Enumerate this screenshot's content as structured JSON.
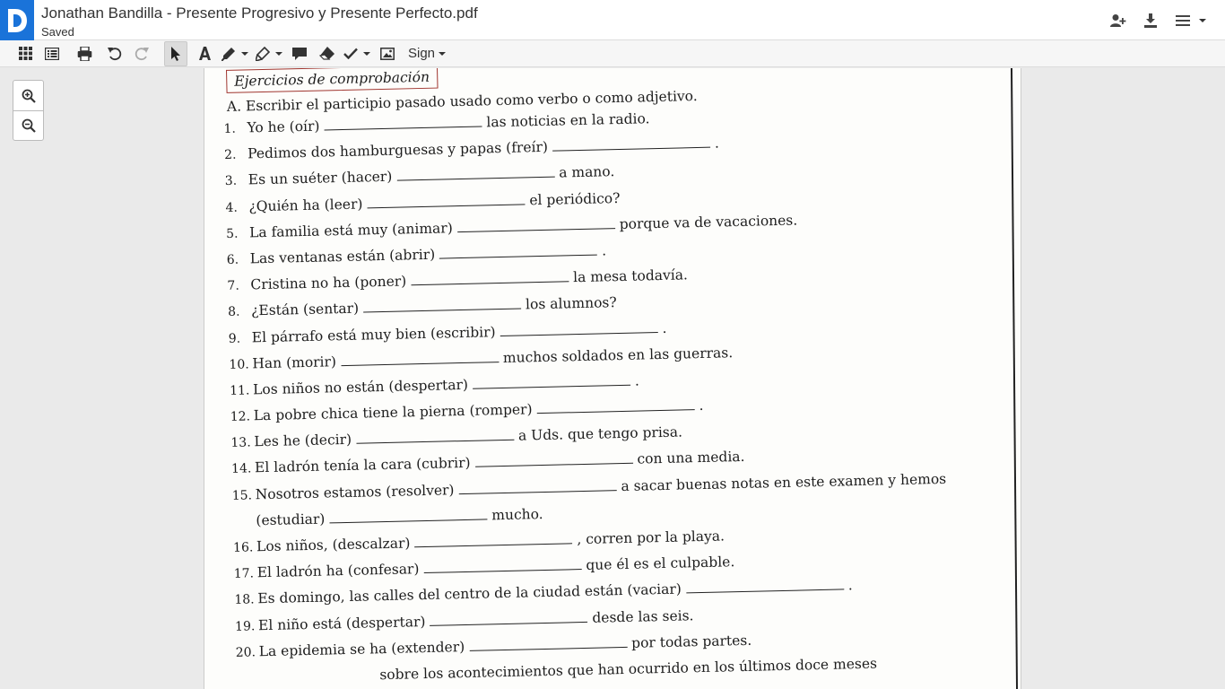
{
  "app": {
    "title": "Jonathan Bandilla - Presente Progresivo y Presente Perfecto.pdf",
    "status": "Saved",
    "logo_letter": "D",
    "accent": "#1a73d9"
  },
  "header_icons": [
    "add-user-icon",
    "download-icon",
    "menu-icon"
  ],
  "toolbar": {
    "sign_label": "Sign",
    "tools": [
      "grid-icon",
      "list-icon",
      "print-icon",
      "undo-icon",
      "redo-icon",
      "select-icon",
      "text-icon",
      "draw-icon",
      "highlight-icon",
      "comment-icon",
      "eraser-icon",
      "check-icon",
      "image-icon"
    ]
  },
  "zoom": [
    "zoom-in-icon",
    "zoom-out-icon"
  ],
  "document": {
    "section_title": "Ejercicios de comprobación",
    "instruction": "A. Escribir el participio pasado usado como verbo o como adjetivo.",
    "items": [
      {
        "n": "1.",
        "pre": "Yo he (oír)",
        "post": "las noticias en la radio."
      },
      {
        "n": "2.",
        "pre": "Pedimos dos hamburguesas y papas (freír)",
        "post": "."
      },
      {
        "n": "3.",
        "pre": "Es un suéter (hacer)",
        "post": "a mano."
      },
      {
        "n": "4.",
        "pre": "¿Quién ha (leer)",
        "post": "el periódico?"
      },
      {
        "n": "5.",
        "pre": "La familia está muy (animar)",
        "post": "porque va de vacaciones."
      },
      {
        "n": "6.",
        "pre": "Las ventanas están (abrir)",
        "post": "."
      },
      {
        "n": "7.",
        "pre": "Cristina no ha (poner)",
        "post": "la mesa todavía."
      },
      {
        "n": "8.",
        "pre": "¿Están (sentar)",
        "post": "los alumnos?"
      },
      {
        "n": "9.",
        "pre": "El párrafo está muy bien (escribir)",
        "post": "."
      },
      {
        "n": "10.",
        "pre": "Han (morir)",
        "post": "muchos soldados en las guerras."
      },
      {
        "n": "11.",
        "pre": "Los niños no están (despertar)",
        "post": "."
      },
      {
        "n": "12.",
        "pre": "La pobre chica tiene la pierna (romper)",
        "post": "."
      },
      {
        "n": "13.",
        "pre": "Les he (decir)",
        "post": "a Uds. que tengo prisa."
      },
      {
        "n": "14.",
        "pre": "El ladrón tenía la cara (cubrir)",
        "post": "con una media."
      },
      {
        "n": "15.",
        "pre": "Nosotros estamos (resolver)",
        "post": "a sacar buenas notas en este examen y hemos"
      },
      {
        "n": "",
        "pre": "(estudiar)",
        "post": "mucho."
      },
      {
        "n": "16.",
        "pre": "Los niños, (descalzar)",
        "post": ", corren por la playa."
      },
      {
        "n": "17.",
        "pre": "El ladrón ha (confesar)",
        "post": "que él es el culpable."
      },
      {
        "n": "18.",
        "pre": "Es domingo, las calles del centro de la ciudad están (vaciar)",
        "post": "."
      },
      {
        "n": "19.",
        "pre": "El niño está (despertar)",
        "post": "desde las seis."
      },
      {
        "n": "20.",
        "pre": "La epidemia se ha (extender)",
        "post": "por todas partes."
      }
    ],
    "partial_line": "sobre los acontecimientos que han ocurrido en los últimos doce meses"
  }
}
